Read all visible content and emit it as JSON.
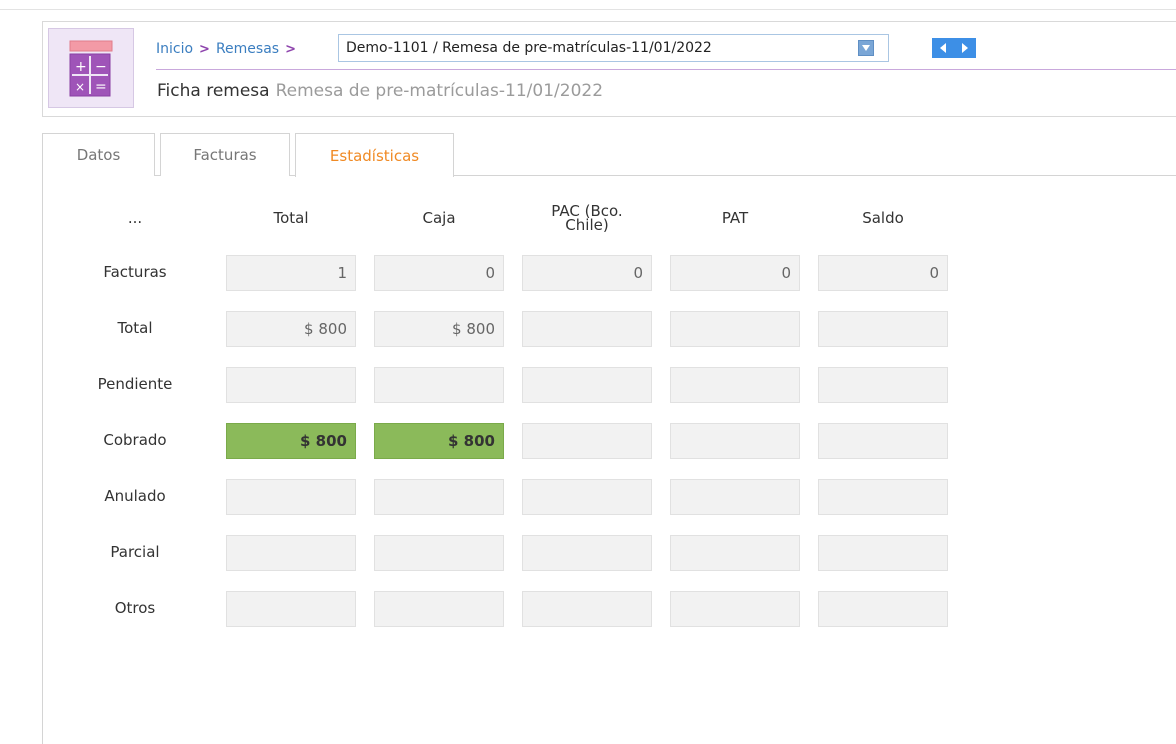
{
  "breadcrumb": {
    "home": "Inicio",
    "section": "Remesas",
    "separator": ">"
  },
  "record_select": {
    "value": "Demo-1101 / Remesa de pre-matrículas-11/01/2022"
  },
  "form": {
    "title": "Ficha remesa",
    "subtitle": "Remesa de pre-matrículas-11/01/2022"
  },
  "tabs": [
    {
      "label": "Datos"
    },
    {
      "label": "Facturas"
    },
    {
      "label": "Estadísticas"
    }
  ],
  "active_tab": "Estadísticas",
  "table": {
    "headers": [
      "...",
      "Total",
      "Caja",
      "PAC (Bco.\nChile)",
      "PAT",
      "Saldo"
    ],
    "rows": [
      {
        "label": "Facturas",
        "values": [
          "1",
          "0",
          "0",
          "0",
          "0"
        ]
      },
      {
        "label": "Total",
        "values": [
          "$ 800",
          "$ 800",
          "",
          "",
          ""
        ]
      },
      {
        "label": "Pendiente",
        "values": [
          "",
          "",
          "",
          "",
          ""
        ]
      },
      {
        "label": "Cobrado",
        "values": [
          "$ 800",
          "$ 800",
          "",
          "",
          ""
        ],
        "highlight": [
          true,
          true,
          false,
          false,
          false
        ]
      },
      {
        "label": "Anulado",
        "values": [
          "",
          "",
          "",
          "",
          ""
        ]
      },
      {
        "label": "Parcial",
        "values": [
          "",
          "",
          "",
          "",
          ""
        ]
      },
      {
        "label": "Otros",
        "values": [
          "",
          "",
          "",
          "",
          ""
        ]
      }
    ]
  },
  "colors": {
    "link": "#3b7ec0",
    "active_tab": "#f08a24",
    "accent_purple": "#8e44ad",
    "highlight_green": "#8bba5a"
  },
  "icons": {
    "app": "calculator-icon",
    "select": "chevron-down-icon",
    "prev": "arrow-left-icon",
    "next": "arrow-right-icon"
  }
}
